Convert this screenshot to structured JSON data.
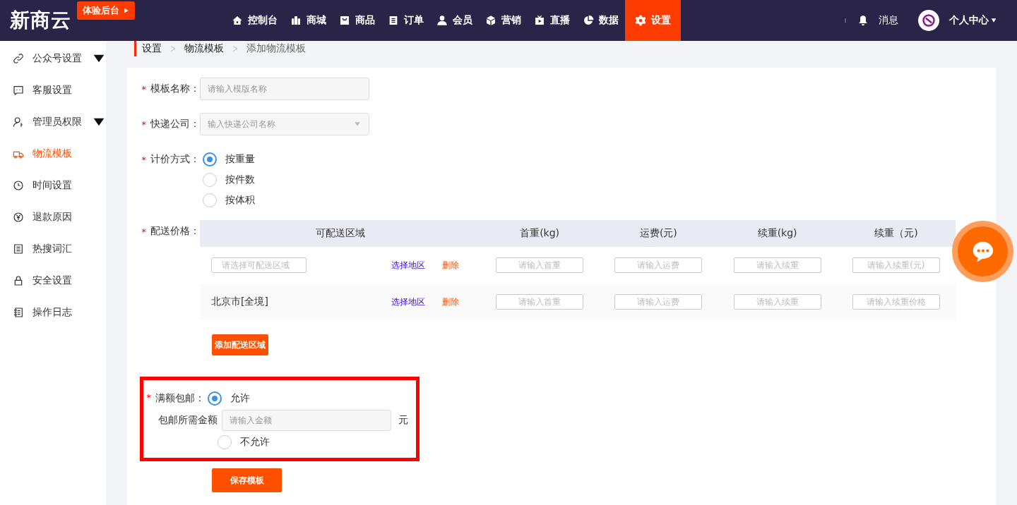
{
  "header": {
    "logo": "新商云",
    "trial_button": "体验后台",
    "nav": [
      {
        "label": "控制台",
        "selected": false
      },
      {
        "label": "商城",
        "selected": false
      },
      {
        "label": "商品",
        "selected": false
      },
      {
        "label": "订单",
        "selected": false
      },
      {
        "label": "会员",
        "selected": false
      },
      {
        "label": "营销",
        "selected": false
      },
      {
        "label": "直播",
        "selected": false
      },
      {
        "label": "数据",
        "selected": false
      },
      {
        "label": "设置",
        "selected": true
      }
    ],
    "messages": "消息",
    "user": "个人中心"
  },
  "sidebar": {
    "items": [
      {
        "label": "公众号设置",
        "selected": false,
        "expandable": true
      },
      {
        "label": "客服设置",
        "selected": false,
        "expandable": false
      },
      {
        "label": "管理员权限",
        "selected": false,
        "expandable": true
      },
      {
        "label": "物流模板",
        "selected": true,
        "expandable": false
      },
      {
        "label": "时间设置",
        "selected": false,
        "expandable": false
      },
      {
        "label": "退款原因",
        "selected": false,
        "expandable": false
      },
      {
        "label": "热搜词汇",
        "selected": false,
        "expandable": false
      },
      {
        "label": "安全设置",
        "selected": false,
        "expandable": false
      },
      {
        "label": "操作日志",
        "selected": false,
        "expandable": false
      }
    ]
  },
  "breadcrumb": [
    "设置",
    "物流模板",
    "添加物流模板"
  ],
  "form": {
    "name": {
      "label": "模板名称：",
      "required_mark": "*",
      "placeholder": "请输入模版名称"
    },
    "courier": {
      "label": "快递公司：",
      "required_mark": "*",
      "placeholder": "输入快递公司名称"
    },
    "pricing": {
      "label": "计价方式：",
      "required_mark": "*",
      "options": [
        {
          "label": "按重量",
          "selected": true
        },
        {
          "label": "按件数",
          "selected": false
        },
        {
          "label": "按体积",
          "selected": false
        }
      ]
    },
    "delivery": {
      "label": "配送价格：",
      "required_mark": "*",
      "columns": [
        "可配送区域",
        "首重(kg)",
        "运费(元)",
        "续重(kg)",
        "续重（元)"
      ],
      "rows": [
        {
          "region": {
            "kind": "field",
            "text": "请选择可配送区域"
          },
          "select_link": "选择地区",
          "delete_link": "删除",
          "placeholders": [
            "请输入首重",
            "请输入运费",
            "请输入续重",
            "请输入续重(元)"
          ]
        },
        {
          "region": {
            "kind": "text",
            "text": "北京市[全境]"
          },
          "select_link": "选择地区",
          "delete_link": "删除",
          "placeholders": [
            "请输入首重",
            "请输入运费",
            "请输入续重",
            "请输入续重价格"
          ]
        }
      ],
      "add_button": "添加配送区域"
    },
    "free_shipping": {
      "label": "满额包邮：",
      "required_mark": "*",
      "highlighted": true,
      "options": [
        {
          "label": "允许",
          "selected": true
        },
        {
          "label": "不允许",
          "selected": false
        }
      ],
      "amount": {
        "label": "包邮所需金额",
        "placeholder": "请输入金额",
        "unit": "元"
      }
    },
    "save_button": "保存模板"
  }
}
